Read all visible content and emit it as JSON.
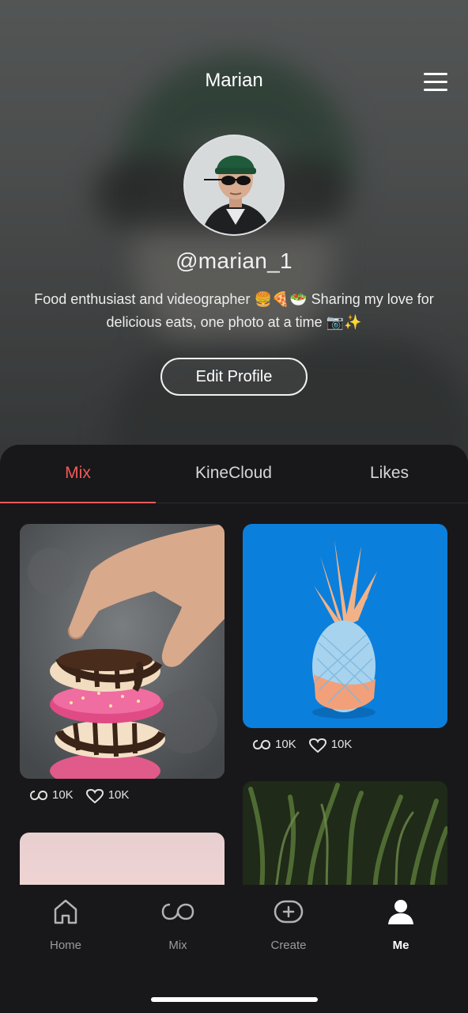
{
  "header": {
    "title": "Marian",
    "menu_icon": "hamburger-menu-icon"
  },
  "profile": {
    "handle": "@marian_1",
    "bio": "Food enthusiast and videographer 🍔🍕🥗 Sharing my love for delicious eats, one photo at a time 📷✨",
    "edit_button_label": "Edit Profile"
  },
  "tabs": [
    {
      "label": "Mix",
      "active": true
    },
    {
      "label": "KineCloud",
      "active": false
    },
    {
      "label": "Likes",
      "active": false
    }
  ],
  "colors": {
    "accent": "#ef5a5a",
    "background": "#18181a",
    "text_muted": "#9a9a9a"
  },
  "posts": [
    {
      "subject": "donut stack",
      "remix_count": "10K",
      "like_count": "10K"
    },
    {
      "subject": "painted pineapple",
      "remix_count": "10K",
      "like_count": "10K"
    },
    {
      "subject": "pink gradient"
    },
    {
      "subject": "green grass"
    }
  ],
  "nav": {
    "items": [
      {
        "label": "Home",
        "icon": "home-icon",
        "active": false
      },
      {
        "label": "Mix",
        "icon": "mix-icon",
        "active": false
      },
      {
        "label": "Create",
        "icon": "create-icon",
        "active": false
      },
      {
        "label": "Me",
        "icon": "profile-icon",
        "active": true
      }
    ]
  }
}
